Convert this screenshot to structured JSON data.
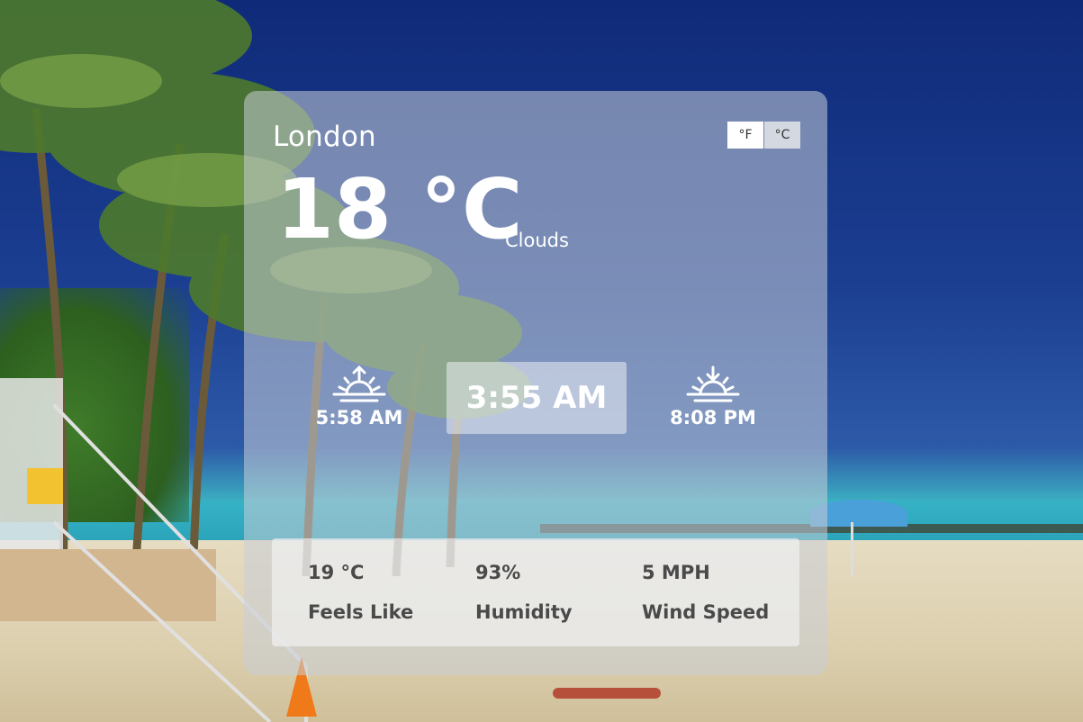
{
  "weather": {
    "city": "London",
    "temperature": "18 °C",
    "condition": "Clouds",
    "units": {
      "fahrenheit_label": "°F",
      "celsius_label": "°C",
      "selected": "°C"
    },
    "sunrise": "5:58 AM",
    "sunset": "8:08 PM",
    "current_time": "3:55 AM",
    "details": {
      "feels_like_value": "19 °C",
      "feels_like_label": "Feels Like",
      "humidity_value": "93%",
      "humidity_label": "Humidity",
      "wind_value": "5 MPH",
      "wind_label": "Wind Speed"
    }
  },
  "icons": {
    "sunrise": "sunrise-icon",
    "sunset": "sunset-icon"
  },
  "colors": {
    "card_bg": "#c8cdd7",
    "text_primary": "#ffffff",
    "text_stats": "#4a4a4a"
  }
}
